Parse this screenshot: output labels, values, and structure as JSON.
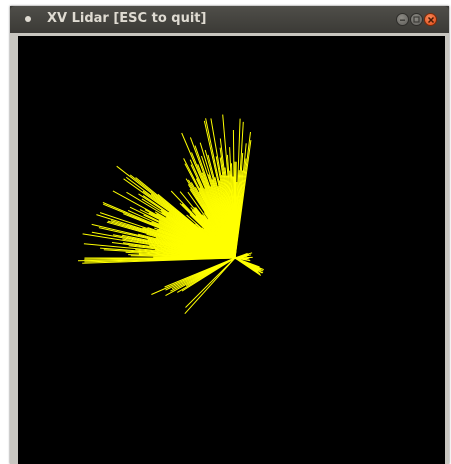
{
  "window": {
    "title": "XV Lidar [ESC to quit]",
    "title_icon": "dot-icon",
    "buttons": [
      "minimize-icon",
      "maximize-icon",
      "close-icon"
    ]
  },
  "lidar_view": {
    "background_color": "#000000",
    "ray_color": "#ffff00",
    "origin_label": ""
  }
}
